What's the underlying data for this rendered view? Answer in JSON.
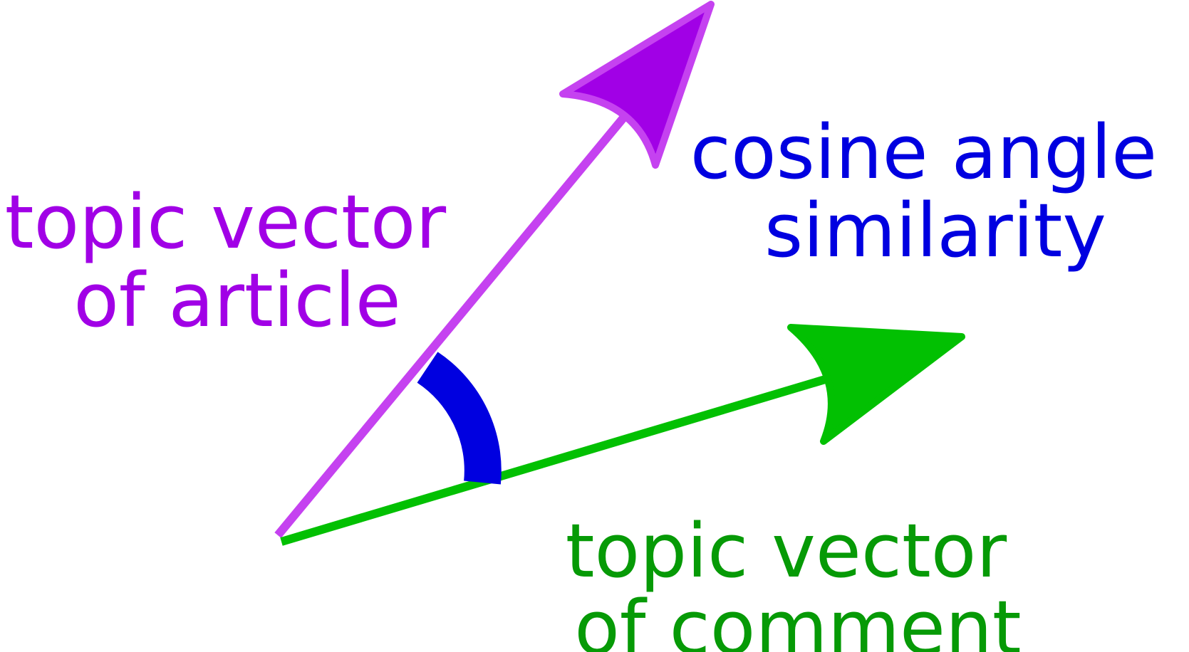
{
  "labels": {
    "article": [
      "topic vector",
      "of article"
    ],
    "comment": [
      "topic vector",
      "of comment"
    ],
    "angle": [
      "cosine angle",
      "similarity"
    ]
  },
  "colors": {
    "article": "#a100e6",
    "article_line": "#c542f0",
    "comment": "#02c002",
    "comment_text": "#069a06",
    "angle": "#0000e0"
  }
}
